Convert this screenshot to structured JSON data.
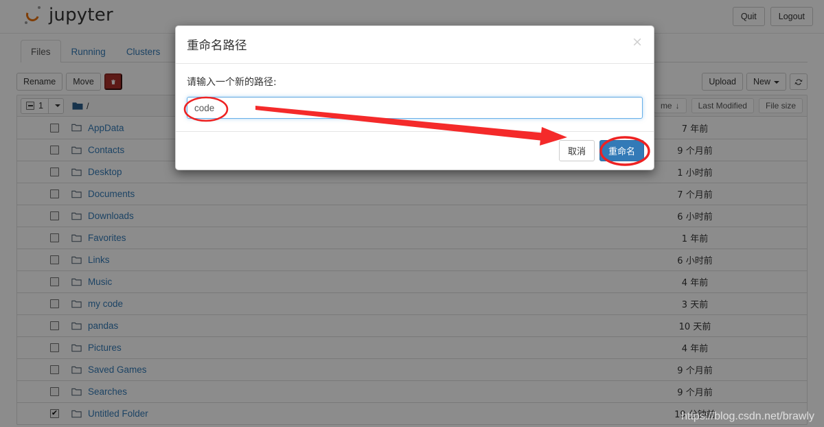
{
  "header": {
    "brand": "jupyter",
    "logo_icon": "jupyter-logo-icon",
    "quit_label": "Quit",
    "logout_label": "Logout"
  },
  "tabs": [
    {
      "label": "Files",
      "active": true
    },
    {
      "label": "Running",
      "active": false
    },
    {
      "label": "Clusters",
      "active": false
    }
  ],
  "toolbar": {
    "rename_label": "Rename",
    "move_label": "Move",
    "delete_icon": "trash-icon",
    "upload_label": "Upload",
    "new_label": "New",
    "refresh_icon": "refresh-icon"
  },
  "list_header": {
    "selected_count": "1",
    "breadcrumb": "/",
    "folder_icon": "folder-icon",
    "sort_name_label": "me",
    "sort_name_arrow": "↓",
    "last_modified_label": "Last Modified",
    "file_size_label": "File size"
  },
  "files": [
    {
      "name": "AppData",
      "modified": "7 年前",
      "checked": false
    },
    {
      "name": "Contacts",
      "modified": "9 个月前",
      "checked": false
    },
    {
      "name": "Desktop",
      "modified": "1 小时前",
      "checked": false
    },
    {
      "name": "Documents",
      "modified": "7 个月前",
      "checked": false
    },
    {
      "name": "Downloads",
      "modified": "6 小时前",
      "checked": false
    },
    {
      "name": "Favorites",
      "modified": "1 年前",
      "checked": false
    },
    {
      "name": "Links",
      "modified": "6 小时前",
      "checked": false
    },
    {
      "name": "Music",
      "modified": "4 年前",
      "checked": false
    },
    {
      "name": "my code",
      "modified": "3 天前",
      "checked": false
    },
    {
      "name": "pandas",
      "modified": "10 天前",
      "checked": false
    },
    {
      "name": "Pictures",
      "modified": "4 年前",
      "checked": false
    },
    {
      "name": "Saved Games",
      "modified": "9 个月前",
      "checked": false
    },
    {
      "name": "Searches",
      "modified": "9 个月前",
      "checked": false
    },
    {
      "name": "Untitled Folder",
      "modified": "19 分钟前",
      "checked": true
    }
  ],
  "modal": {
    "title": "重命名路径",
    "close_icon": "close-icon",
    "label": "请输入一个新的路径:",
    "input_value": "code",
    "input_placeholder": "",
    "cancel_label": "取消",
    "confirm_label": "重命名"
  },
  "annotations": {
    "ellipse_input": "highlight-ellipse-input",
    "ellipse_button": "highlight-ellipse-rename-button",
    "arrow": "pointer-arrow"
  },
  "watermark": "https://blog.csdn.net/brawly",
  "colors": {
    "accent_blue": "#337ab7",
    "link_blue": "#337ab7",
    "danger_red": "#a9302a",
    "annotation_red": "#ee2222",
    "jupyter_orange": "#e8700a",
    "focus_border": "#66afe9"
  }
}
